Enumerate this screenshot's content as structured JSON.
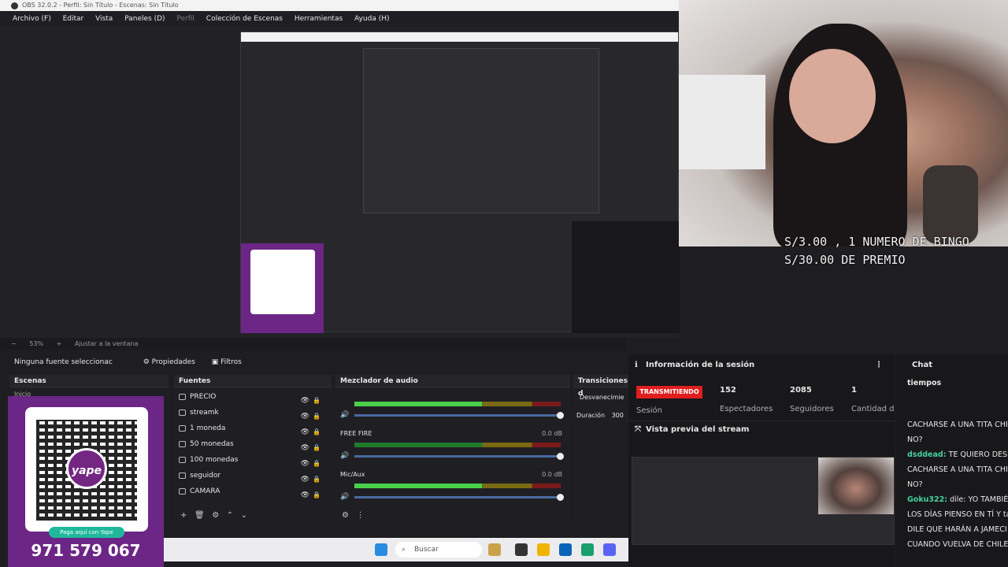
{
  "window": {
    "title": "OBS 32.0.2 - Perfil: Sin Título - Escenas: Sin Título"
  },
  "menu": [
    "Archivo (F)",
    "Editar",
    "Vista",
    "Paneles (D)",
    "Perfil",
    "Colección de Escenas",
    "Herramientas",
    "Ayuda (H)"
  ],
  "overlay": {
    "line1": "S/3.00 , 1 NUMERO DE BINGO",
    "line2": "S/30.00 DE PREMIO"
  },
  "zoom": {
    "level": "53%",
    "fit": "Ajustar a la ventana"
  },
  "propbar": {
    "no_source": "Ninguna fuente seleccionac",
    "properties": "Propiedades",
    "filters": "Filtros"
  },
  "scenes": {
    "title": "Escenas",
    "items": [
      "Inicio"
    ]
  },
  "sources": {
    "title": "Fuentes",
    "items": [
      "PRECIO",
      "streamk",
      "1 moneda",
      "50 monedas",
      "100 monedas",
      "seguidor",
      "CAMARA"
    ]
  },
  "mixer": {
    "title": "Mezclador de audio",
    "channels": [
      {
        "name": "",
        "db": "",
        "level": 0.62
      },
      {
        "name": "FREE FIRE",
        "db": "0.0 dB",
        "level": 0.0
      },
      {
        "name": "Mic/Aux",
        "db": "0.0 dB",
        "level": 0.62
      }
    ]
  },
  "transitions": {
    "title": "Transiciones d",
    "selected": "Desvanecimie",
    "duration_label": "Duración",
    "duration_value": "300"
  },
  "qr": {
    "brand": "yape",
    "pill": "Paga aquí con Yape",
    "phone": "971 579 067"
  },
  "taskbar": {
    "search": "Buscar"
  },
  "session": {
    "title": "Información de la sesión",
    "live_badge": "TRANSMITIENDO",
    "session_label": "Sesión",
    "stats": [
      {
        "value": "152",
        "label": "Espectadores"
      },
      {
        "value": "2085",
        "label": "Seguidores"
      },
      {
        "value": "1",
        "label": "Cantidad d"
      }
    ],
    "preview_title": "Vista previa del stream"
  },
  "chat": {
    "title": "Chat",
    "pinned": "tiempos",
    "messages": [
      {
        "user": "",
        "text": "CACHARSE A UNA TITA CHIL"
      },
      {
        "user": "",
        "text": "NO?"
      },
      {
        "user": "dsddead:",
        "text": " TE QUIERO DESPU"
      },
      {
        "user": "",
        "text": "CACHARSE A UNA TITA CHIL"
      },
      {
        "user": "",
        "text": "NO?"
      },
      {
        "user": "Goku322:",
        "text": " dile: YO TAMBIÉN,"
      },
      {
        "user": "",
        "text": "LOS DÍAS PIENSO EN TÍ Y ta"
      },
      {
        "user": "",
        "text": "DILE QUE HARÁN A JAMECI"
      },
      {
        "user": "",
        "text": "CUANDO VUELVA DE CHILE"
      }
    ]
  },
  "colors": {
    "accent_live": "#e01e1e",
    "yape_purple": "#6b2686",
    "yape_green": "#1fb89c",
    "chat_user": "#45d0a0"
  }
}
